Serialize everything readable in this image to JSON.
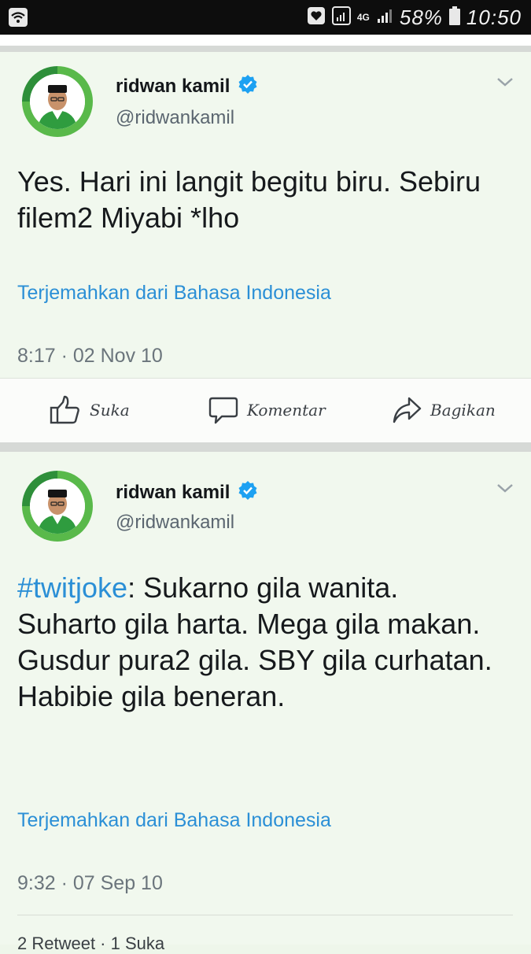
{
  "status_bar": {
    "network": "4G",
    "battery": "58%",
    "time": "10:50"
  },
  "tweets": [
    {
      "name": "ridwan kamil",
      "handle": "@ridwankamil",
      "text": "Yes. Hari ini langit begitu biru. Sebiru filem2 Miyabi *lho",
      "translate": "Terjemahkan dari Bahasa Indonesia",
      "timestamp": "8:17 · 02 Nov 10"
    },
    {
      "name": "ridwan kamil",
      "handle": "@ridwankamil",
      "hashtag": "#twitjoke",
      "text": ": Sukarno gila wanita. Suharto gila harta. Mega gila makan. Gusdur pura2 gila. SBY gila curhatan. Habibie gila beneran.",
      "translate": "Terjemahkan dari Bahasa Indonesia",
      "timestamp": "9:32 · 07 Sep 10",
      "footer_partial": "2 Retweet · 1 Suka"
    }
  ],
  "actions": {
    "like": "Suka",
    "comment": "Komentar",
    "share": "Bagikan"
  },
  "colors": {
    "accent": "#2b8fd6",
    "verified": "#1da1f2",
    "avatar_ring": "#59b94a",
    "background": "#f1f8ee"
  }
}
